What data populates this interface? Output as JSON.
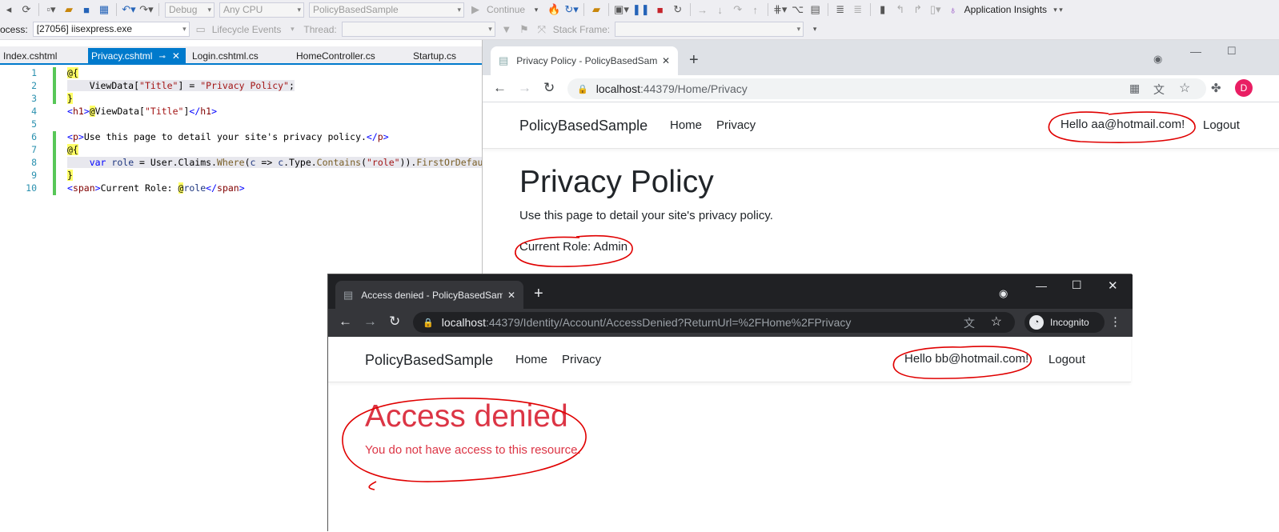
{
  "vs": {
    "toolbar": {
      "config": "Debug",
      "platform": "Any CPU",
      "project": "PolicyBasedSample",
      "continue_label": "Continue",
      "app_insights": "Application Insights"
    },
    "toolbar2": {
      "process_label": "ocess:",
      "process_value": "[27056] iisexpress.exe",
      "lifecycle": "Lifecycle Events",
      "thread_label": "Thread:",
      "stack_label": "Stack Frame:"
    },
    "tabs": [
      {
        "label": "Index.cshtml"
      },
      {
        "label": "Privacy.cshtml"
      },
      {
        "label": "Login.cshtml.cs"
      },
      {
        "label": "HomeController.cs"
      },
      {
        "label": "Startup.cs"
      }
    ],
    "line_numbers": [
      "1",
      "2",
      "3",
      "4",
      "5",
      "6",
      "7",
      "8",
      "9",
      "10"
    ]
  },
  "browser1": {
    "tab_title": "Privacy Policy - PolicyBasedSamp",
    "url_host": "localhost",
    "url_rest": ":44379/Home/Privacy",
    "avatar": "D",
    "brand": "PolicyBasedSample",
    "nav": {
      "home": "Home",
      "privacy": "Privacy"
    },
    "hello": "Hello aa@hotmail.com!",
    "logout": "Logout",
    "heading": "Privacy Policy",
    "paragraph": "Use this page to detail your site's privacy policy.",
    "role": "Current Role: Admin"
  },
  "browser2": {
    "tab_title": "Access denied - PolicyBasedSamp",
    "url_host": "localhost",
    "url_rest": ":44379/Identity/Account/AccessDenied?ReturnUrl=%2FHome%2FPrivacy",
    "incognito": "Incognito",
    "brand": "PolicyBasedSample",
    "nav": {
      "home": "Home",
      "privacy": "Privacy"
    },
    "hello": "Hello bb@hotmail.com!",
    "logout": "Logout",
    "heading": "Access denied",
    "message": "You do not have access to this resource."
  },
  "colors": {
    "vs_accent": "#007acc",
    "denied_red": "#dc3545",
    "annotation": "#e00000"
  }
}
